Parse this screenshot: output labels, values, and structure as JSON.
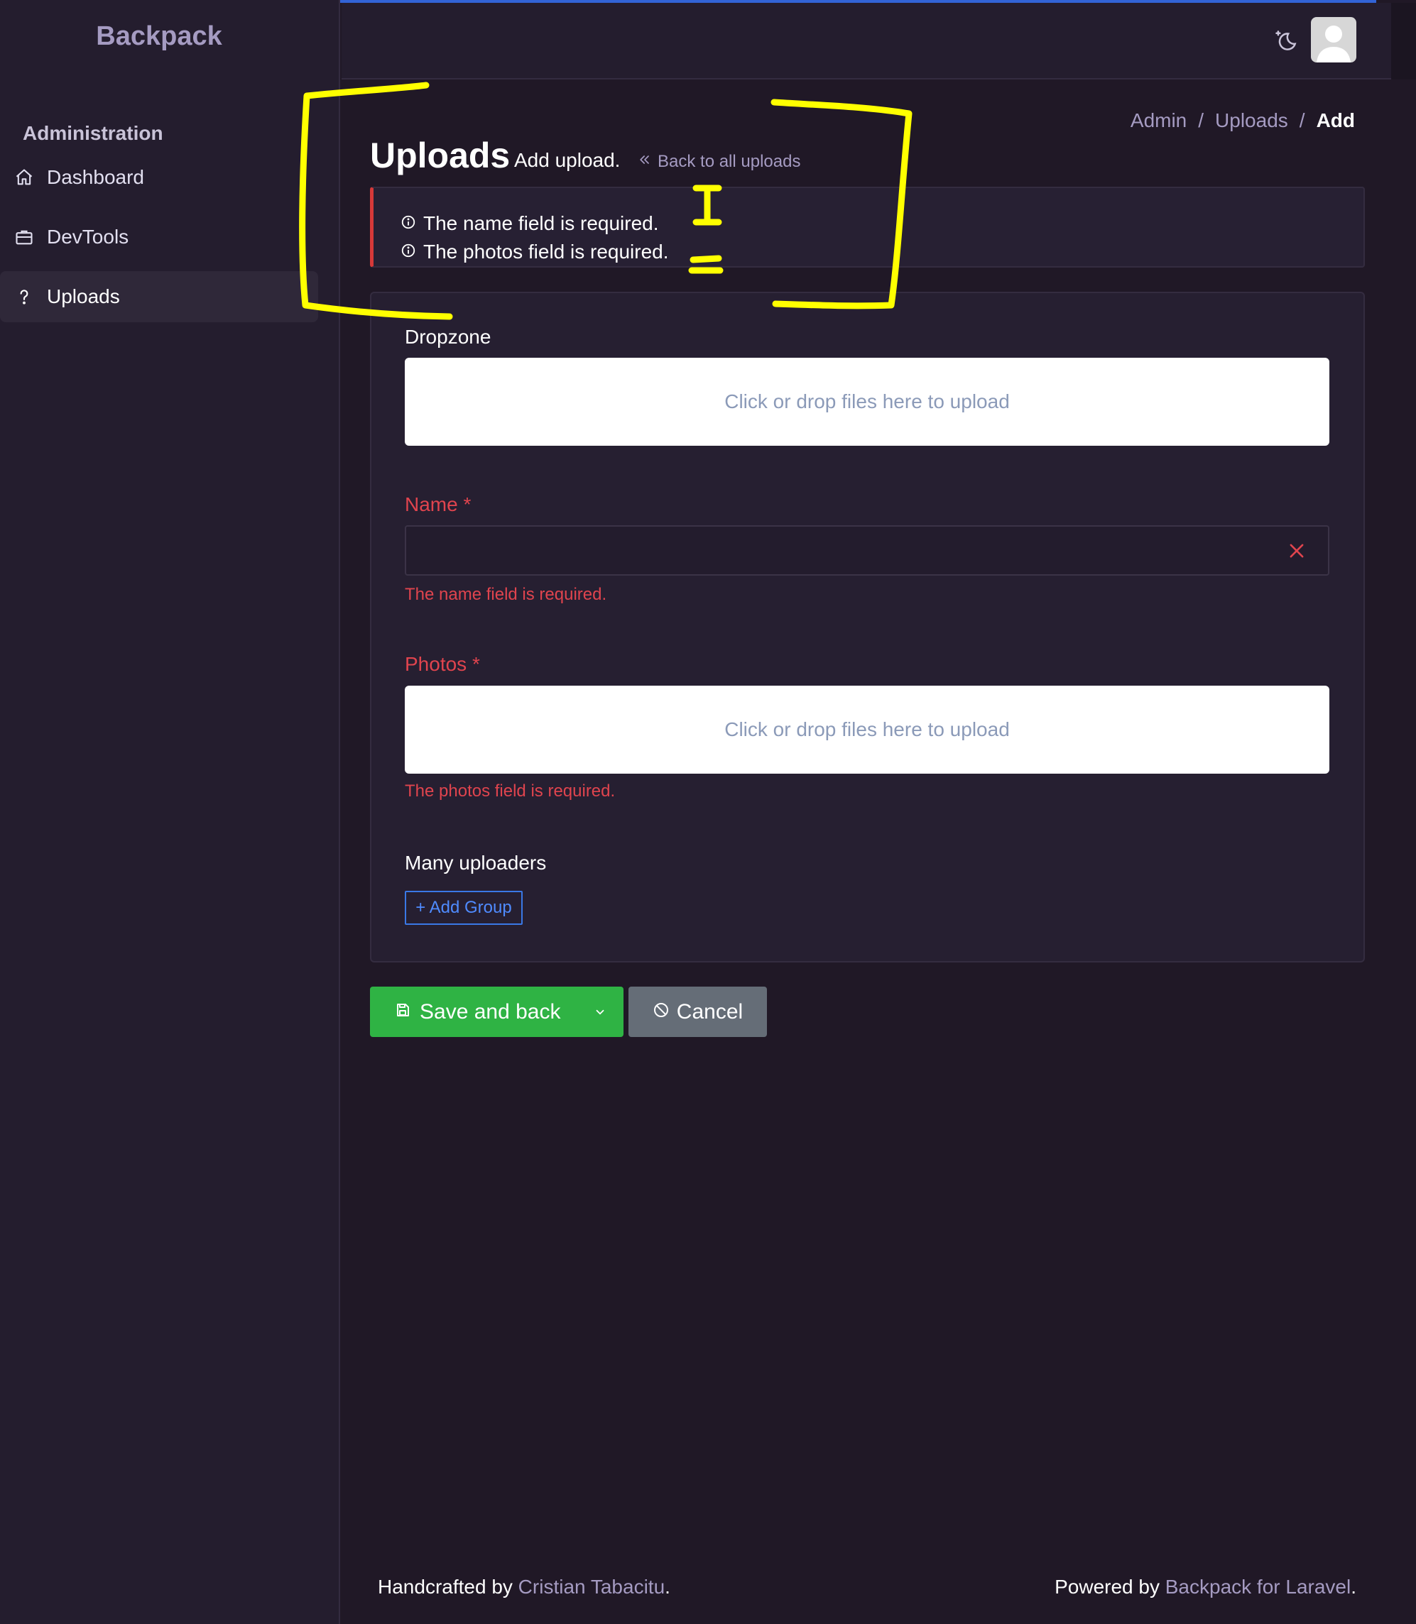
{
  "brand": "Backpack",
  "sidebar": {
    "section_title": "Administration",
    "items": [
      {
        "label": "Dashboard",
        "icon": "home-icon"
      },
      {
        "label": "DevTools",
        "icon": "briefcase-icon"
      },
      {
        "label": "Uploads",
        "icon": "question-icon",
        "active": true
      }
    ]
  },
  "header": {
    "theme_icon": "moon-stars-icon",
    "avatar_icon": "user-avatar-icon"
  },
  "breadcrumb": {
    "items": [
      "Admin",
      "Uploads",
      "Add"
    ],
    "separator": "/"
  },
  "page": {
    "title": "Uploads",
    "subtitle": "Add upload.",
    "back_link": "Back to all uploads"
  },
  "alert": {
    "errors": [
      "The name field is required.",
      "The photos field is required."
    ]
  },
  "form": {
    "dropzone": {
      "label": "Dropzone",
      "placeholder": "Click or drop files here to upload"
    },
    "name": {
      "label": "Name",
      "required_marker": "*",
      "value": "",
      "error": "The name field is required."
    },
    "photos": {
      "label": "Photos",
      "required_marker": "*",
      "placeholder": "Click or drop files here to upload",
      "error": "The photos field is required."
    },
    "many_uploaders": {
      "label": "Many uploaders",
      "add_button": "+ Add Group"
    }
  },
  "actions": {
    "save_label": "Save and back",
    "cancel_label": "Cancel"
  },
  "footer": {
    "left_prefix": "Handcrafted by",
    "left_link": "Cristian Tabacitu",
    "left_suffix": ".",
    "right_prefix": "Powered by",
    "right_link": "Backpack for Laravel",
    "right_suffix": "."
  },
  "colors": {
    "background": "#201826",
    "sidebar": "#241d2e",
    "accent_blue": "#3263d6",
    "error_red": "#e0444e",
    "save_green": "#2fb344",
    "cancel_gray": "#656d77",
    "annotation_yellow": "#ffff00"
  }
}
